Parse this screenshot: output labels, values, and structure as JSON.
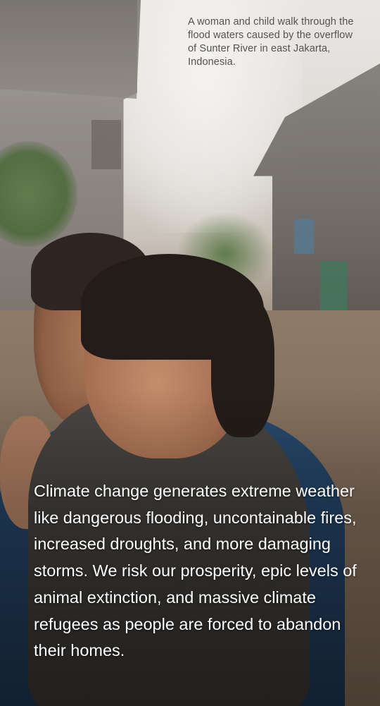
{
  "photo": {
    "caption": "A woman and child walk through the flood waters caused by the overflow of Sunter River in east Jakarta, Indonesia."
  },
  "story": {
    "body": "Climate change generates extreme weather like dangerous flooding, uncontainable fires, increased droughts, and more damaging storms. We risk our prosperity, epic levels of animal extinction, and massive climate refugees as people are forced to abandon their homes."
  }
}
